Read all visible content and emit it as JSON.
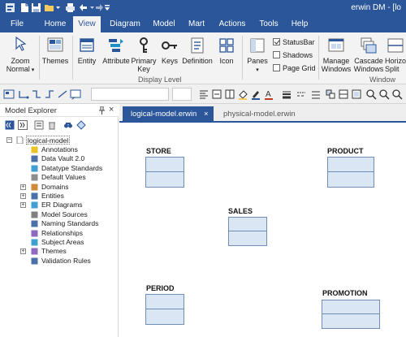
{
  "app": {
    "window_title": "erwin DM - [lo",
    "colors": {
      "accent": "#2b579a",
      "entity_fill": "#dbe6f5",
      "entity_border": "#6f8fb5",
      "ribbon_bg": "#f3f3f3"
    }
  },
  "quick_access": [
    "app-icon",
    "new-icon",
    "save-icon",
    "folder-icon",
    "print-icon",
    "undo-icon",
    "redo-icon",
    "customize-icon"
  ],
  "menu": {
    "tabs": [
      {
        "label": "File"
      },
      {
        "label": "Home"
      },
      {
        "label": "View"
      },
      {
        "label": "Diagram"
      },
      {
        "label": "Model"
      },
      {
        "label": "Mart"
      },
      {
        "label": "Actions"
      },
      {
        "label": "Tools"
      },
      {
        "label": "Help"
      }
    ],
    "active": "View"
  },
  "ribbon": {
    "zoom_label": "Zoom Normal",
    "zoom_line1": "Zoom",
    "zoom_line2": "Normal",
    "themes": "Themes",
    "entity": "Entity",
    "attribute": "Attribute",
    "primary_line1": "Primary",
    "primary_line2": "Key",
    "keys": "Keys",
    "definition": "Definition",
    "icon": "Icon",
    "panes": "Panes",
    "statusbar": "StatusBar",
    "shadows": "Shadows",
    "page_grid": "Page Grid",
    "manage_line1": "Manage",
    "manage_line2": "Windows",
    "cascade_line1": "Cascade",
    "cascade_line2": "Windows",
    "horizon_line1": "Horizon",
    "horizon_line2": "Split",
    "group_display_level": "Display Level",
    "group_window": "Window",
    "checkbox_states": {
      "statusbar": true,
      "shadows": false,
      "page_grid": false
    }
  },
  "explorer": {
    "title": "Model Explorer",
    "close": "×",
    "root": "logical-model",
    "items": [
      {
        "label": "Annotations",
        "icon": "annotation-icon",
        "expandable": false
      },
      {
        "label": "Data Vault 2.0",
        "icon": "data-vault-icon",
        "expandable": false
      },
      {
        "label": "Datatype Standards",
        "icon": "datatype-icon",
        "expandable": false
      },
      {
        "label": "Default Values",
        "icon": "default-values-icon",
        "expandable": false
      },
      {
        "label": "Domains",
        "icon": "domain-icon",
        "expandable": true
      },
      {
        "label": "Entities",
        "icon": "entity-icon",
        "expandable": true
      },
      {
        "label": "ER Diagrams",
        "icon": "er-diagram-icon",
        "expandable": true
      },
      {
        "label": "Model Sources",
        "icon": "model-source-icon",
        "expandable": false
      },
      {
        "label": "Naming Standards",
        "icon": "naming-icon",
        "expandable": false
      },
      {
        "label": "Relationships",
        "icon": "relationship-icon",
        "expandable": false
      },
      {
        "label": "Subject Areas",
        "icon": "subject-area-icon",
        "expandable": false
      },
      {
        "label": "Themes",
        "icon": "theme-icon",
        "expandable": true
      },
      {
        "label": "Validation Rules",
        "icon": "validation-icon",
        "expandable": false
      }
    ]
  },
  "tabs": {
    "active": "logical-model.erwin",
    "close": "×",
    "inactive": "physical-model.erwin"
  },
  "diagram": {
    "entities": [
      {
        "name": "STORE"
      },
      {
        "name": "PRODUCT"
      },
      {
        "name": "SALES"
      },
      {
        "name": "PERIOD"
      },
      {
        "name": "PROMOTION"
      }
    ]
  }
}
